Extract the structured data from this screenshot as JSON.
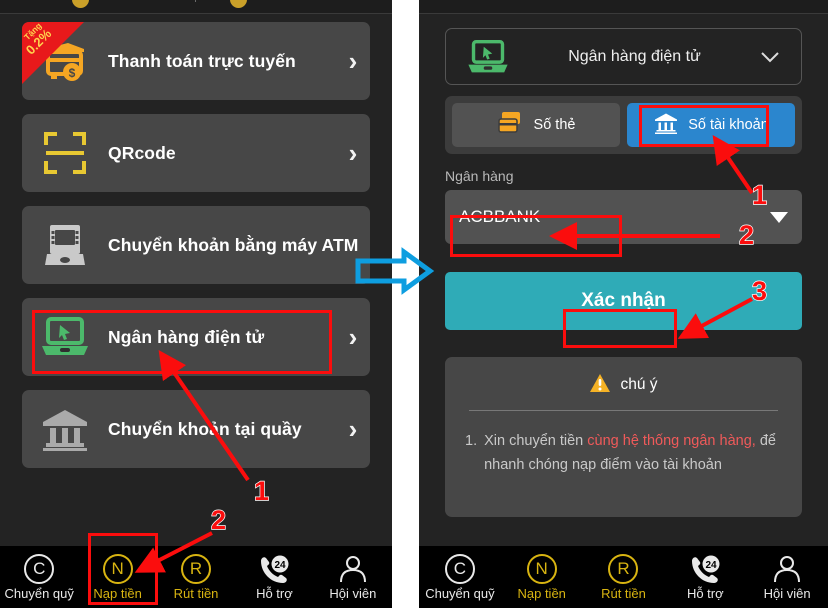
{
  "left_panel": {
    "promo_ribbon": {
      "line1": "Tặng",
      "line2": "0.2%"
    },
    "items": [
      {
        "label": "Thanh toán trực tuyến",
        "icon": "card-payment-icon",
        "chevron": "›"
      },
      {
        "label": "QRcode",
        "icon": "qrcode-scan-icon",
        "chevron": "›"
      },
      {
        "label": "Chuyển khoản bằng máy ATM",
        "icon": "atm-machine-icon",
        "chevron": "›"
      },
      {
        "label": "Ngân hàng điện tử",
        "icon": "laptop-ebanking-icon",
        "chevron": "›"
      },
      {
        "label": "Chuyển khoản tại quầy",
        "icon": "bank-building-icon",
        "chevron": "›"
      }
    ]
  },
  "right_panel": {
    "method_header": {
      "label": "Ngân hàng điện tử",
      "icon": "laptop-ebanking-icon",
      "chevron": "⌄"
    },
    "segments": [
      {
        "label": "Số thẻ",
        "icon": "card-stack-icon",
        "active": false
      },
      {
        "label": "Số tài khoản",
        "icon": "bank-building-icon",
        "active": true
      }
    ],
    "bank_field": {
      "label": "Ngân hàng",
      "value": "ACBBANK",
      "placeholder": "Ngân hàng"
    },
    "confirm_button": "Xác nhận",
    "note": {
      "icon": "warning-triangle-icon",
      "title": "chú ý",
      "number": "1.",
      "text_before": "Xin chuyển tiền ",
      "text_highlight": "cùng hệ thống ngân hàng,",
      "text_after": " để nhanh chóng nạp điểm vào tài khoản"
    }
  },
  "bottom_nav": {
    "items": [
      {
        "label": "Chuyển quỹ",
        "glyph": "C",
        "icon": "transfer-fund-icon",
        "state": "inactive"
      },
      {
        "label": "Nạp tiền",
        "glyph": "N",
        "icon": "deposit-icon",
        "state": "active"
      },
      {
        "label": "Rút tiền",
        "glyph": "R",
        "icon": "withdraw-icon",
        "state": "active"
      },
      {
        "label": "Hỗ trợ",
        "glyph": "24",
        "icon": "support-phone-24-icon",
        "state": "inactive"
      },
      {
        "label": "Hội viên",
        "glyph": "",
        "icon": "member-person-icon",
        "state": "inactive"
      }
    ]
  },
  "annotations": {
    "left": [
      {
        "number": "1",
        "target": "ngan-hang-dien-tu-row"
      },
      {
        "number": "2",
        "target": "nav-nap-tien"
      }
    ],
    "right": [
      {
        "number": "1",
        "target": "so-tai-khoan-tab"
      },
      {
        "number": "2",
        "target": "acbbank-value"
      },
      {
        "number": "3",
        "target": "xac-nhan-button"
      }
    ],
    "flow_arrow": "blue-right-arrow"
  },
  "colors": {
    "page_bg": "#232323",
    "card_bg": "#474747",
    "accent_teal": "#2fabb7",
    "accent_blue": "#2b86ce",
    "annotation_red": "#fb0d0d",
    "annotation_green": "#22b24c",
    "flow_blue": "#0e9ee0",
    "gold": "#d8b411",
    "green_icon": "#4cb96b",
    "orange_icon": "#f5a623",
    "highlight_red_text": "#f05a5a"
  }
}
